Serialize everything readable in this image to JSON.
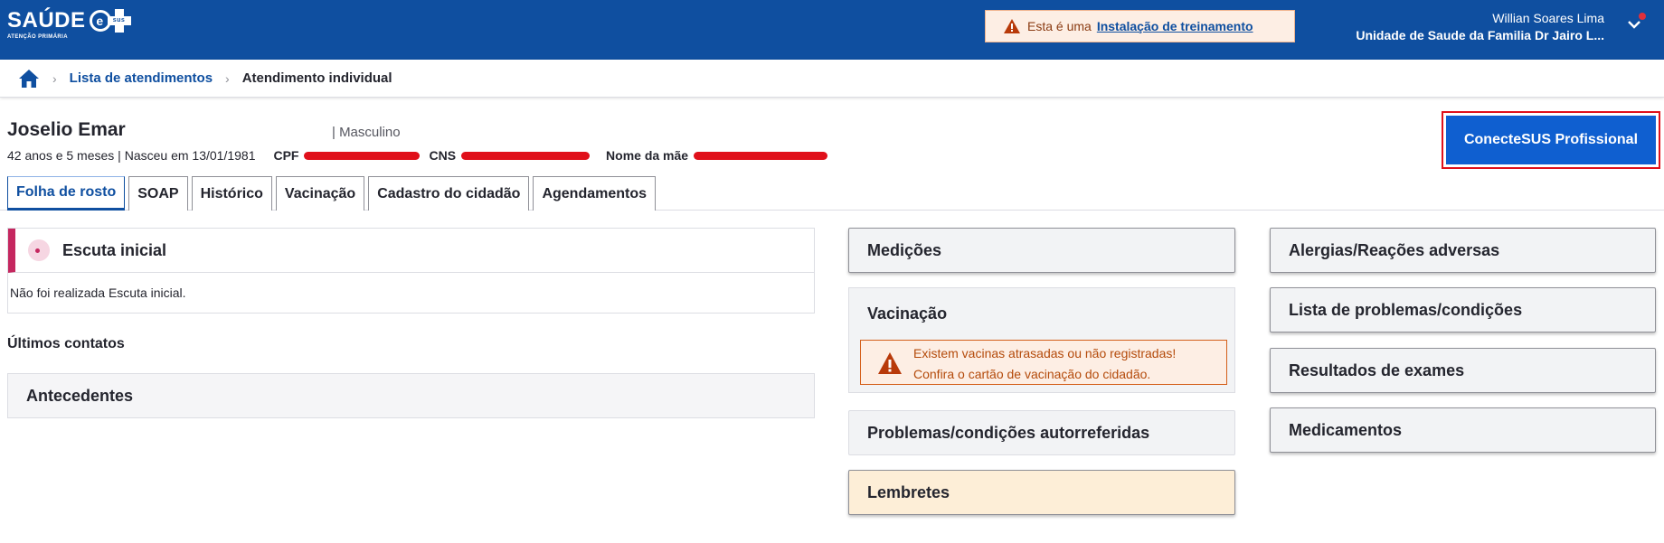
{
  "header": {
    "logo_text": "SAÚDE",
    "logo_badge": "sus",
    "logo_sub": "ATENÇÃO PRIMÁRIA",
    "training_prefix": "Esta é uma",
    "training_link": "Instalação de treinamento",
    "user_name": "Willian Soares Lima",
    "user_unit": "Unidade de Saude da Familia Dr Jairo L..."
  },
  "breadcrumb": {
    "items": [
      "Lista de atendimentos",
      "Atendimento individual"
    ]
  },
  "patient": {
    "name": "Joselio Emar",
    "sex": "| Masculino",
    "age_birth": "42 anos e 5 meses | Nasceu em 13/01/1981",
    "cpf_label": "CPF",
    "cns_label": "CNS",
    "mother_label": "Nome da mãe",
    "conecte_button": "ConecteSUS Profissional"
  },
  "tabs": [
    "Folha de rosto",
    "SOAP",
    "Histórico",
    "Vacinação",
    "Cadastro do cidadão",
    "Agendamentos"
  ],
  "left": {
    "escuta_title": "Escuta inicial",
    "escuta_text": "Não foi realizada Escuta inicial.",
    "ultimos": "Últimos contatos",
    "antecedentes": "Antecedentes"
  },
  "middle": {
    "medicoes": "Medições",
    "vacinacao": "Vacinação",
    "vac_alert_line1": "Existem vacinas atrasadas ou não registradas!",
    "vac_alert_line2": "Confira o cartão de vacinação do cidadão.",
    "problemas": "Problemas/condições autorreferidas",
    "lembretes": "Lembretes"
  },
  "right": {
    "alergias": "Alergias/Reações adversas",
    "lista_problemas": "Lista de problemas/condições",
    "resultados": "Resultados de exames",
    "medicamentos": "Medicamentos"
  },
  "colors": {
    "brand": "#0f4fa0",
    "redaction": "#e0101a",
    "warning": "#d45f1a"
  }
}
